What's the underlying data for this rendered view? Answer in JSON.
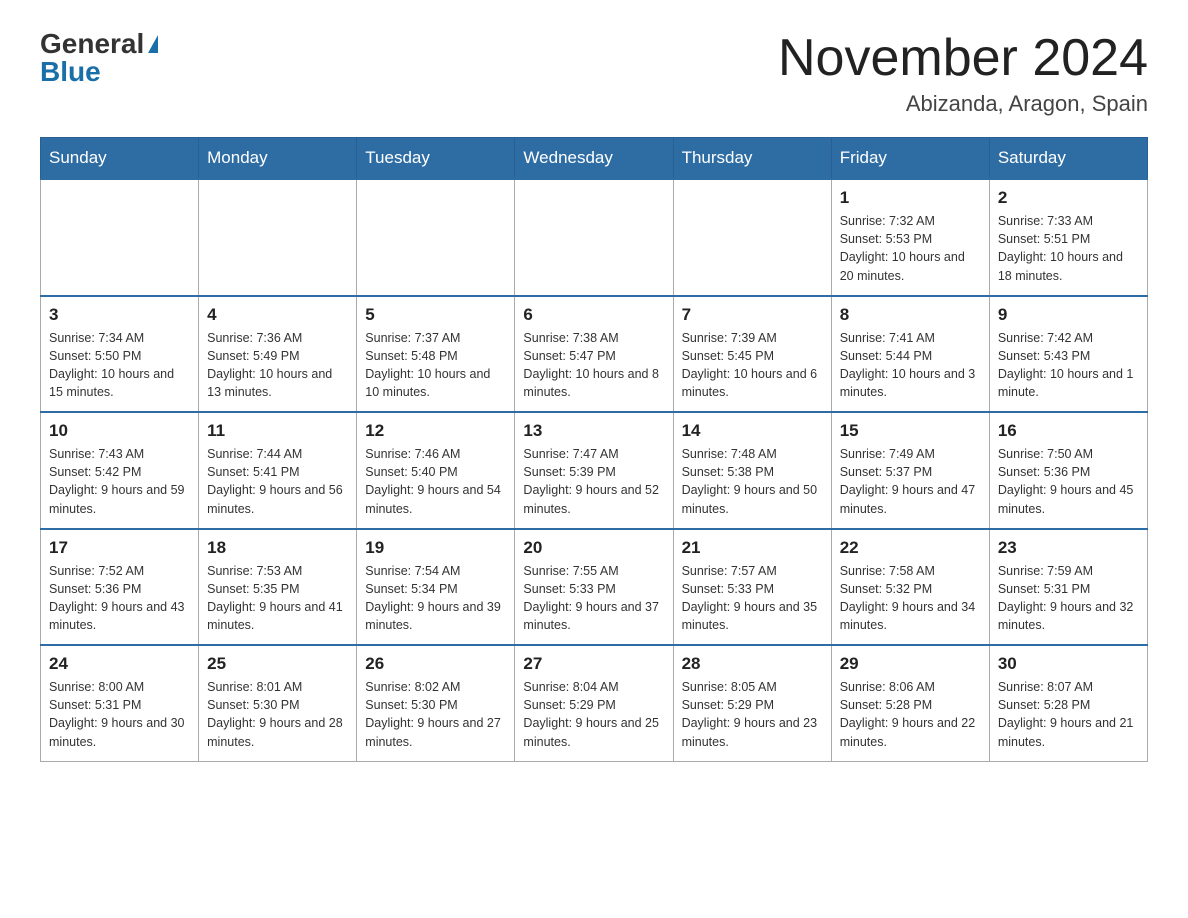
{
  "header": {
    "logo_general": "General",
    "logo_blue": "Blue",
    "month_title": "November 2024",
    "location": "Abizanda, Aragon, Spain"
  },
  "days_of_week": [
    "Sunday",
    "Monday",
    "Tuesday",
    "Wednesday",
    "Thursday",
    "Friday",
    "Saturday"
  ],
  "weeks": [
    [
      {
        "day": "",
        "sunrise": "",
        "sunset": "",
        "daylight": ""
      },
      {
        "day": "",
        "sunrise": "",
        "sunset": "",
        "daylight": ""
      },
      {
        "day": "",
        "sunrise": "",
        "sunset": "",
        "daylight": ""
      },
      {
        "day": "",
        "sunrise": "",
        "sunset": "",
        "daylight": ""
      },
      {
        "day": "",
        "sunrise": "",
        "sunset": "",
        "daylight": ""
      },
      {
        "day": "1",
        "sunrise": "Sunrise: 7:32 AM",
        "sunset": "Sunset: 5:53 PM",
        "daylight": "Daylight: 10 hours and 20 minutes."
      },
      {
        "day": "2",
        "sunrise": "Sunrise: 7:33 AM",
        "sunset": "Sunset: 5:51 PM",
        "daylight": "Daylight: 10 hours and 18 minutes."
      }
    ],
    [
      {
        "day": "3",
        "sunrise": "Sunrise: 7:34 AM",
        "sunset": "Sunset: 5:50 PM",
        "daylight": "Daylight: 10 hours and 15 minutes."
      },
      {
        "day": "4",
        "sunrise": "Sunrise: 7:36 AM",
        "sunset": "Sunset: 5:49 PM",
        "daylight": "Daylight: 10 hours and 13 minutes."
      },
      {
        "day": "5",
        "sunrise": "Sunrise: 7:37 AM",
        "sunset": "Sunset: 5:48 PM",
        "daylight": "Daylight: 10 hours and 10 minutes."
      },
      {
        "day": "6",
        "sunrise": "Sunrise: 7:38 AM",
        "sunset": "Sunset: 5:47 PM",
        "daylight": "Daylight: 10 hours and 8 minutes."
      },
      {
        "day": "7",
        "sunrise": "Sunrise: 7:39 AM",
        "sunset": "Sunset: 5:45 PM",
        "daylight": "Daylight: 10 hours and 6 minutes."
      },
      {
        "day": "8",
        "sunrise": "Sunrise: 7:41 AM",
        "sunset": "Sunset: 5:44 PM",
        "daylight": "Daylight: 10 hours and 3 minutes."
      },
      {
        "day": "9",
        "sunrise": "Sunrise: 7:42 AM",
        "sunset": "Sunset: 5:43 PM",
        "daylight": "Daylight: 10 hours and 1 minute."
      }
    ],
    [
      {
        "day": "10",
        "sunrise": "Sunrise: 7:43 AM",
        "sunset": "Sunset: 5:42 PM",
        "daylight": "Daylight: 9 hours and 59 minutes."
      },
      {
        "day": "11",
        "sunrise": "Sunrise: 7:44 AM",
        "sunset": "Sunset: 5:41 PM",
        "daylight": "Daylight: 9 hours and 56 minutes."
      },
      {
        "day": "12",
        "sunrise": "Sunrise: 7:46 AM",
        "sunset": "Sunset: 5:40 PM",
        "daylight": "Daylight: 9 hours and 54 minutes."
      },
      {
        "day": "13",
        "sunrise": "Sunrise: 7:47 AM",
        "sunset": "Sunset: 5:39 PM",
        "daylight": "Daylight: 9 hours and 52 minutes."
      },
      {
        "day": "14",
        "sunrise": "Sunrise: 7:48 AM",
        "sunset": "Sunset: 5:38 PM",
        "daylight": "Daylight: 9 hours and 50 minutes."
      },
      {
        "day": "15",
        "sunrise": "Sunrise: 7:49 AM",
        "sunset": "Sunset: 5:37 PM",
        "daylight": "Daylight: 9 hours and 47 minutes."
      },
      {
        "day": "16",
        "sunrise": "Sunrise: 7:50 AM",
        "sunset": "Sunset: 5:36 PM",
        "daylight": "Daylight: 9 hours and 45 minutes."
      }
    ],
    [
      {
        "day": "17",
        "sunrise": "Sunrise: 7:52 AM",
        "sunset": "Sunset: 5:36 PM",
        "daylight": "Daylight: 9 hours and 43 minutes."
      },
      {
        "day": "18",
        "sunrise": "Sunrise: 7:53 AM",
        "sunset": "Sunset: 5:35 PM",
        "daylight": "Daylight: 9 hours and 41 minutes."
      },
      {
        "day": "19",
        "sunrise": "Sunrise: 7:54 AM",
        "sunset": "Sunset: 5:34 PM",
        "daylight": "Daylight: 9 hours and 39 minutes."
      },
      {
        "day": "20",
        "sunrise": "Sunrise: 7:55 AM",
        "sunset": "Sunset: 5:33 PM",
        "daylight": "Daylight: 9 hours and 37 minutes."
      },
      {
        "day": "21",
        "sunrise": "Sunrise: 7:57 AM",
        "sunset": "Sunset: 5:33 PM",
        "daylight": "Daylight: 9 hours and 35 minutes."
      },
      {
        "day": "22",
        "sunrise": "Sunrise: 7:58 AM",
        "sunset": "Sunset: 5:32 PM",
        "daylight": "Daylight: 9 hours and 34 minutes."
      },
      {
        "day": "23",
        "sunrise": "Sunrise: 7:59 AM",
        "sunset": "Sunset: 5:31 PM",
        "daylight": "Daylight: 9 hours and 32 minutes."
      }
    ],
    [
      {
        "day": "24",
        "sunrise": "Sunrise: 8:00 AM",
        "sunset": "Sunset: 5:31 PM",
        "daylight": "Daylight: 9 hours and 30 minutes."
      },
      {
        "day": "25",
        "sunrise": "Sunrise: 8:01 AM",
        "sunset": "Sunset: 5:30 PM",
        "daylight": "Daylight: 9 hours and 28 minutes."
      },
      {
        "day": "26",
        "sunrise": "Sunrise: 8:02 AM",
        "sunset": "Sunset: 5:30 PM",
        "daylight": "Daylight: 9 hours and 27 minutes."
      },
      {
        "day": "27",
        "sunrise": "Sunrise: 8:04 AM",
        "sunset": "Sunset: 5:29 PM",
        "daylight": "Daylight: 9 hours and 25 minutes."
      },
      {
        "day": "28",
        "sunrise": "Sunrise: 8:05 AM",
        "sunset": "Sunset: 5:29 PM",
        "daylight": "Daylight: 9 hours and 23 minutes."
      },
      {
        "day": "29",
        "sunrise": "Sunrise: 8:06 AM",
        "sunset": "Sunset: 5:28 PM",
        "daylight": "Daylight: 9 hours and 22 minutes."
      },
      {
        "day": "30",
        "sunrise": "Sunrise: 8:07 AM",
        "sunset": "Sunset: 5:28 PM",
        "daylight": "Daylight: 9 hours and 21 minutes."
      }
    ]
  ]
}
